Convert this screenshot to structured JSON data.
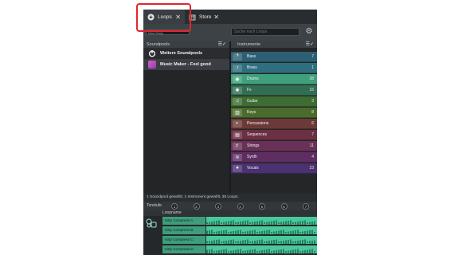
{
  "tabs": [
    {
      "label": "Loops",
      "icon": "loops-icon"
    },
    {
      "label": "Store",
      "icon": "store-icon"
    }
  ],
  "toolbar": {
    "preset_value": "New Song",
    "search_placeholder": "Suche nach Loops"
  },
  "soundpools": {
    "header": "Soundpools",
    "items": [
      {
        "label": "Weitere Soundpools",
        "icon": "power-icon"
      },
      {
        "label": "Music Maker - Feel good",
        "icon": "pool-thumbnail"
      }
    ]
  },
  "instruments": {
    "header": "Instrumente",
    "items": [
      {
        "label": "Bass",
        "count": "7",
        "color": "#2d5f73",
        "icon": "bass-icon"
      },
      {
        "label": "Brass",
        "count": "1",
        "color": "#2f6f7d",
        "icon": "brass-icon"
      },
      {
        "label": "Drums",
        "count": "38",
        "color": "#3fa07c",
        "icon": "drums-icon"
      },
      {
        "label": "Fx",
        "count": "15",
        "color": "#326e52",
        "icon": "fx-icon"
      },
      {
        "label": "Guitar",
        "count": "3",
        "color": "#3e6d33",
        "icon": "guitar-icon"
      },
      {
        "label": "Keys",
        "count": "8",
        "color": "#4b6b2c",
        "icon": "keys-icon"
      },
      {
        "label": "Percussions",
        "count": "6",
        "color": "#6b3a38",
        "icon": "percussion-icon"
      },
      {
        "label": "Sequences",
        "count": "7",
        "color": "#6a3043",
        "icon": "sequences-icon"
      },
      {
        "label": "Strings",
        "count": "11",
        "color": "#6a3158",
        "icon": "strings-icon"
      },
      {
        "label": "Synth",
        "count": "4",
        "color": "#5e2e62",
        "icon": "synth-icon"
      },
      {
        "label": "Vocals",
        "count": "23",
        "color": "#4a3170",
        "icon": "vocals-icon"
      }
    ]
  },
  "status": "1 Soundpool gewählt, 1 Instrument gewählt, 38 Loops.",
  "tonstufe": {
    "label": "Tonstufe",
    "buttons": [
      "1",
      "2",
      "3",
      "4",
      "5",
      "6",
      "7"
    ]
  },
  "loops": {
    "header": "Loopname",
    "items": [
      {
        "name": "Kitty Compress A"
      },
      {
        "name": "Kitty Compress B"
      },
      {
        "name": "Kitty Compress C"
      },
      {
        "name": "Kitty Compress D"
      }
    ]
  },
  "colors": {
    "highlight": "#e3262b",
    "loop_accent": "#49c99b"
  }
}
